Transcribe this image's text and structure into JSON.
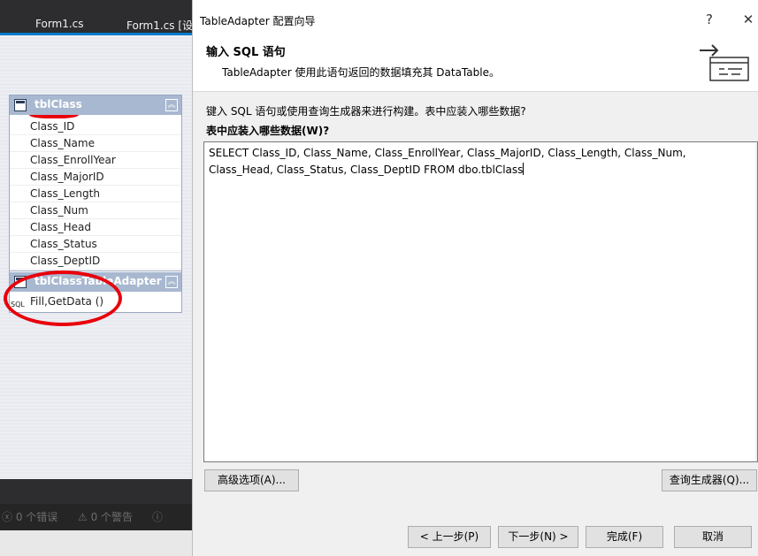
{
  "ide": {
    "tabs": [
      "Form1.cs",
      "Form1.cs [设"
    ],
    "table": {
      "name": "tblClass",
      "columns": [
        "Class_ID",
        "Class_Name",
        "Class_EnrollYear",
        "Class_MajorID",
        "Class_Length",
        "Class_Num",
        "Class_Head",
        "Class_Status",
        "Class_DeptID"
      ],
      "adapter_name": "tblClassTableAdapter",
      "sql_badge": "SQL",
      "method": "Fill,GetData ()"
    },
    "status": {
      "errors": "0 个错误",
      "warnings": "0 个警告"
    }
  },
  "dialog": {
    "title": "TableAdapter 配置向导",
    "help_glyph": "?",
    "close_glyph": "✕",
    "header_title": "输入 SQL 语句",
    "header_subtitle": "TableAdapter 使用此语句返回的数据填充其 DataTable。",
    "instruction": "键入 SQL 语句或使用查询生成器来进行构建。表中应装入哪些数据?",
    "question": "表中应装入哪些数据(W)?",
    "sql_text": "SELECT Class_ID, Class_Name, Class_EnrollYear, Class_MajorID, Class_Length, Class_Num, Class_Head, Class_Status, Class_DeptID FROM dbo.tblClass",
    "buttons": {
      "advanced": "高级选项(A)...",
      "query_builder": "查询生成器(Q)...",
      "prev": "< 上一步(P)",
      "next": "下一步(N) >",
      "finish": "完成(F)",
      "cancel": "取消"
    }
  },
  "colors": {
    "ide_dark": "#2d2d30",
    "accent": "#007acc",
    "table_header": "#a8b8d0",
    "annotation_red": "#e8000b"
  }
}
